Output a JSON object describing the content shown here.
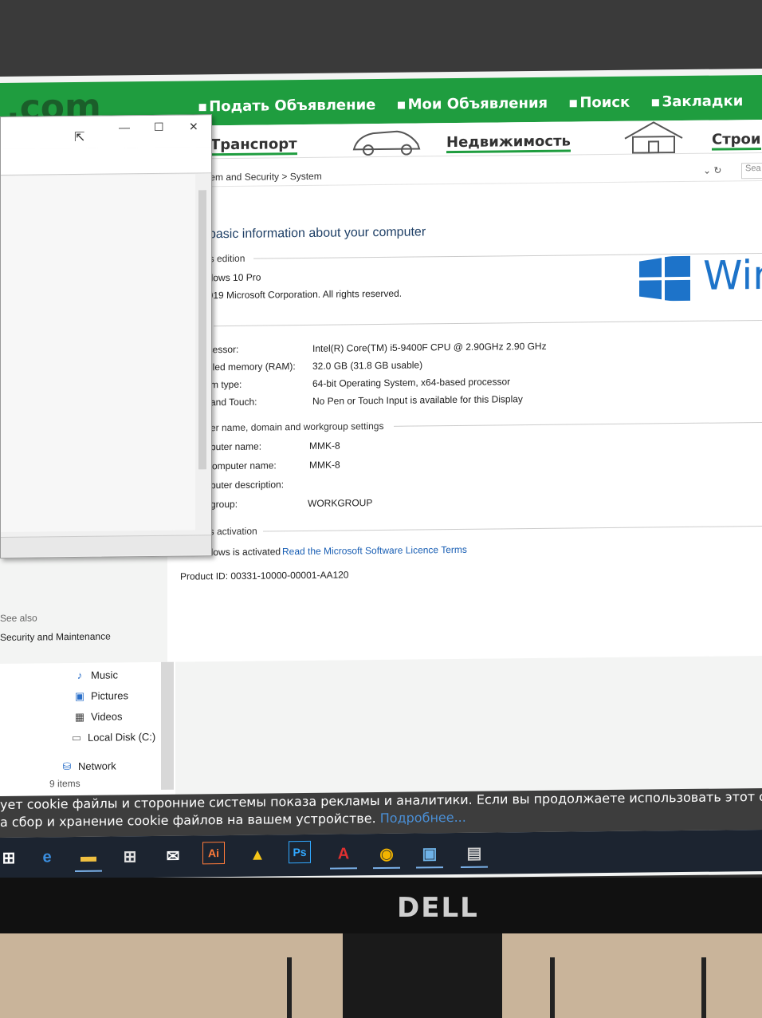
{
  "site": {
    "logo": ".com",
    "nav": [
      "Подать Объявление",
      "Мои Объявления",
      "Поиск",
      "Закладки"
    ],
    "categories": [
      "Транспорт",
      "Недвижимость",
      "Строи"
    ]
  },
  "system_window": {
    "breadcrumb": "tem and Security  >  System",
    "search_placeholder": "Sea",
    "title": "basic information about your computer",
    "edition_section": "ws edition",
    "edition": "ndows 10 Pro",
    "copyright": "2019 Microsoft Corporation. All rights reserved.",
    "win_text": "Win",
    "system_section": "n",
    "rows": [
      {
        "label": "ocessor:",
        "value": "Intel(R) Core(TM) i5-9400F CPU @ 2.90GHz   2.90 GHz"
      },
      {
        "label": "talled memory (RAM):",
        "value": "32.0 GB (31.8 GB usable)"
      },
      {
        "label": "tem type:",
        "value": "64-bit Operating System, x64-based processor"
      },
      {
        "label": "n and Touch:",
        "value": "No Pen or Touch Input is available for this Display"
      }
    ],
    "computer_section": "uter name, domain and workgroup settings",
    "computer_rows": [
      {
        "label": "mputer name:",
        "value": "MMK-8"
      },
      {
        "label": "l computer name:",
        "value": "MMK-8"
      },
      {
        "label": "mputer description:",
        "value": ""
      },
      {
        "label": "rkgroup:",
        "value": "WORKGROUP"
      }
    ],
    "activation_section": "ws activation",
    "activation_status": "ndows is activated",
    "licence_link": "Read the Microsoft Software Licence Terms",
    "product_id": "Product ID:  00331-10000-00001-AA120",
    "see_also": "See also",
    "security_maintenance": "Security and Maintenance"
  },
  "explorer": {
    "nav_items": [
      {
        "icon": "music-icon",
        "label": "Music"
      },
      {
        "icon": "pictures-icon",
        "label": "Pictures"
      },
      {
        "icon": "videos-icon",
        "label": "Videos"
      },
      {
        "icon": "local-disk-icon",
        "label": "Local Disk (C:)"
      },
      {
        "icon": "network-icon",
        "label": "Network"
      }
    ],
    "items_count": "9 items"
  },
  "cookie_banner": {
    "line1": "ует cookie файлы и сторонние системы показа рекламы и аналитики. Если вы продолжаете использовать этот сайт, в",
    "line2": "а сбор и хранение cookie файлов на вашем устройстве.",
    "more": "Подробнее..."
  },
  "taskbar": {
    "apps": [
      "task-view-icon",
      "edge-icon",
      "file-explorer-icon",
      "store-icon",
      "mail-icon",
      "illustrator-icon",
      "archicad-icon",
      "photoshop-icon",
      "autocad-icon",
      "chrome-icon",
      "remote-desktop-icon",
      "system-properties-icon"
    ]
  },
  "monitor": {
    "brand": "DELL"
  }
}
